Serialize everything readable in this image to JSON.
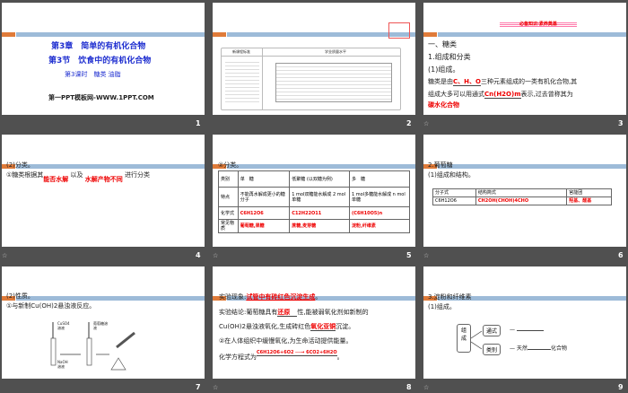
{
  "slides": [
    {
      "number": "1",
      "chapter": "第3章　简单的有机化合物",
      "section": "第3节　饮食中的有机化合物",
      "lesson": "第3课时　糖类 油脂",
      "footer": "第一PPT模板网-WWW.1PPT.COM"
    },
    {
      "number": "2",
      "col1": "新课程标准",
      "col2": "学业质量水平"
    },
    {
      "number": "3",
      "banner": "必备知识·素养奠基",
      "h1": "一、糖类",
      "h2": "1.组成和分类",
      "h3": "(1)组成。",
      "p1a": "糖类是由",
      "p1ans": "C、H、O",
      "p1b": "三种元素组成的一类有机化合物,其",
      "p2a": "组成大多可以用通式",
      "p2ans": "Cn(H2O)m",
      "p2b": "表示,过去曾称其为",
      "p2ans2": "碳水化合物"
    },
    {
      "number": "4",
      "h": "(2)分类。",
      "p1": "①糖类根据其",
      "ans1": "能否水解",
      "p2": "以及",
      "ans2": "水解产物不同",
      "p3": "进行分类"
    },
    {
      "number": "5",
      "h": "②分类。",
      "headers": [
        "类别",
        "单　糖",
        "低聚糖\n(以双糖为例)",
        "多　糖"
      ],
      "rows": [
        [
          "特点",
          "不能再水解成更小的糖分子",
          "1 mol双糖能水解成 2 mol单糖",
          "1 mol多糖能水解成 n mol单糖"
        ],
        [
          "化学式",
          "C6H12O6",
          "C12H22O11",
          "(C6H10O5)n"
        ],
        [
          "常见物质",
          "葡萄糖,果糖",
          "蔗糖,麦芽糖",
          "淀粉,纤维素"
        ]
      ]
    },
    {
      "number": "6",
      "h1": "2.葡萄糖",
      "h2": "(1)组成和结构。",
      "headers": [
        "分子式",
        "结构简式",
        "官能团"
      ],
      "row": [
        "C6H12O6",
        "CH2OH(CHOH)4CHO",
        "羟基、醛基"
      ]
    },
    {
      "number": "7",
      "h1": "(2)性质。",
      "h2": "①与新制Cu(OH)2悬浊液反应。",
      "labels": [
        "CuSO4溶液",
        "葡萄糖溶液",
        "NaOH溶液"
      ]
    },
    {
      "number": "8",
      "l1a": "实验现象:",
      "l1ans": "试管中有砖红色沉淀生成",
      "l2a": "实验结论:葡萄糖具有",
      "l2ans": "还原",
      "l2b": "性,能被弱氧化剂如新制的",
      "l3a": "Cu(OH)2悬浊液氧化,生成砖红色",
      "l3ans": "氧化亚铜",
      "l3b": "沉淀。",
      "l4": "②在人体组织中缓慢氧化,为生命活动提供能量。",
      "l5a": "化学方程式为",
      "l5ans": "C6H12O6+6O2 ──→ 6CO2+6H2O"
    },
    {
      "number": "9",
      "h1": "3.淀粉和纤维素",
      "h2": "(1)组成。",
      "root": "组成",
      "b1": "通式",
      "b2": "类别",
      "tail1": "天然",
      "tail2": "化合物"
    }
  ],
  "colors": {
    "accent": "#e07b39",
    "bar": "#9dbbd8",
    "answer": "#ee0000",
    "title": "#1f2fd0",
    "background": "#505050"
  }
}
